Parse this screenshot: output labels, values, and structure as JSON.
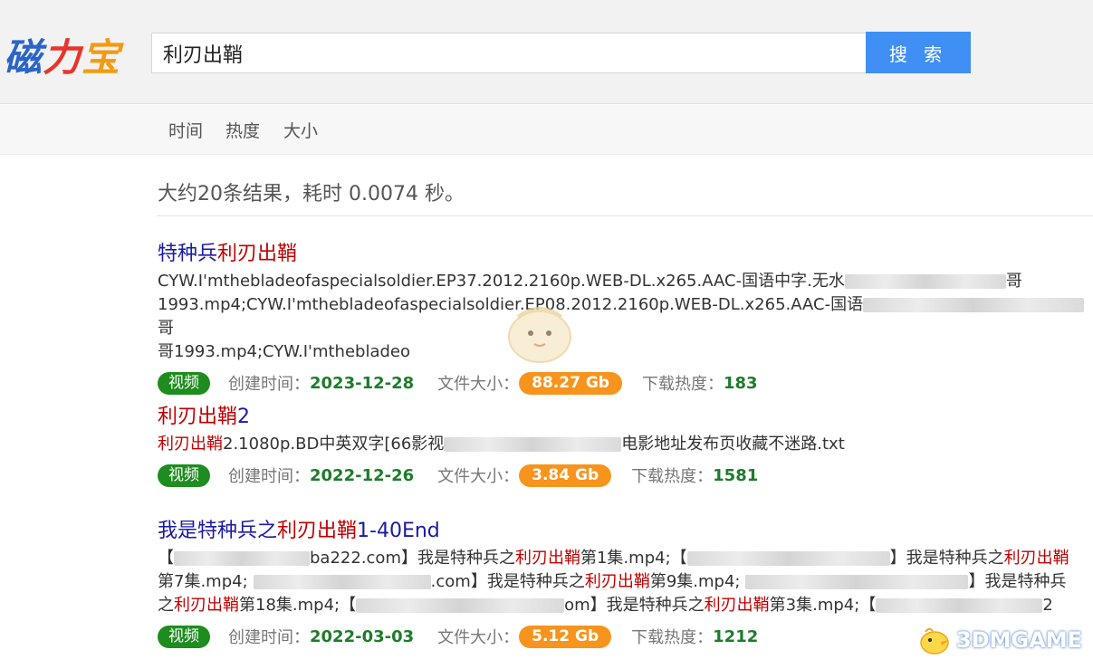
{
  "logo": {
    "chars": [
      "磁",
      "力",
      "宝"
    ],
    "colors": [
      "#2b64c9",
      "#e8352b",
      "#f29b12"
    ]
  },
  "search": {
    "value": "利刃出鞘",
    "button_label": "搜 索"
  },
  "sort": [
    "时间",
    "热度",
    "大小"
  ],
  "summary": "大约20条结果，耗时 0.0074 秒。",
  "meta_labels": {
    "created": "创建时间：",
    "size": "文件大小：",
    "heat": "下载热度："
  },
  "results": [
    {
      "title_pre": "特种兵",
      "title_hl": "利刃出鞘",
      "title_post": "",
      "desc_1": "CYW.I'mthebladeofaspecialsoldier.EP37.2012.2160p.WEB-DL.x265.AAC-国语中字.无水",
      "desc_1b": "哥",
      "desc_2": "1993.mp4;CYW.I'mthebladeofaspecialsoldier.EP08.2012.2160p.WEB-DL.x265.AAC-国语",
      "desc_2b": "哥",
      "desc_3": "哥1993.mp4;CYW.I'mthebladeo",
      "type": "视频",
      "date": "2023-12-28",
      "size": "88.27 Gb",
      "heat": "183"
    },
    {
      "title_pre": "",
      "title_hl": "利刃出鞘",
      "title_post": "2",
      "desc_hl": "利刃出鞘",
      "desc_1": "2.1080p.BD中英双字[66影视",
      "desc_1b": "电影地址发布页收藏不迷路.txt",
      "type": "视频",
      "date": "2022-12-26",
      "size": "3.84 Gb",
      "heat": "1581"
    },
    {
      "title_pre": "我是特种兵之",
      "title_hl": "利刃出鞘",
      "title_post": "1-40End",
      "l1_a": "【",
      "l1_b": "ba222.com】我是特种兵之",
      "l1_hl1": "利刃出鞘",
      "l1_c": "第1集.mp4;【",
      "l1_d": "】我是特种兵之",
      "l1_hl2": "利刃出鞘",
      "l2_a": "第7集.mp4;",
      "l2_b": ".com】我是特种兵之",
      "l2_hl": "利刃出鞘",
      "l2_c": "第9集.mp4;",
      "l2_d": "】我是特种兵",
      "l3_a": "之",
      "l3_hl1": "利刃出鞘",
      "l3_b": "第18集.mp4;【",
      "l3_c": "om】我是特种兵之",
      "l3_hl2": "利刃出鞘",
      "l3_d": "第3集.mp4;【",
      "l3_e": "2",
      "type": "视频",
      "date": "2022-03-03",
      "size": "5.12 Gb",
      "heat": "1212"
    }
  ],
  "watermark": "3DMGAME"
}
